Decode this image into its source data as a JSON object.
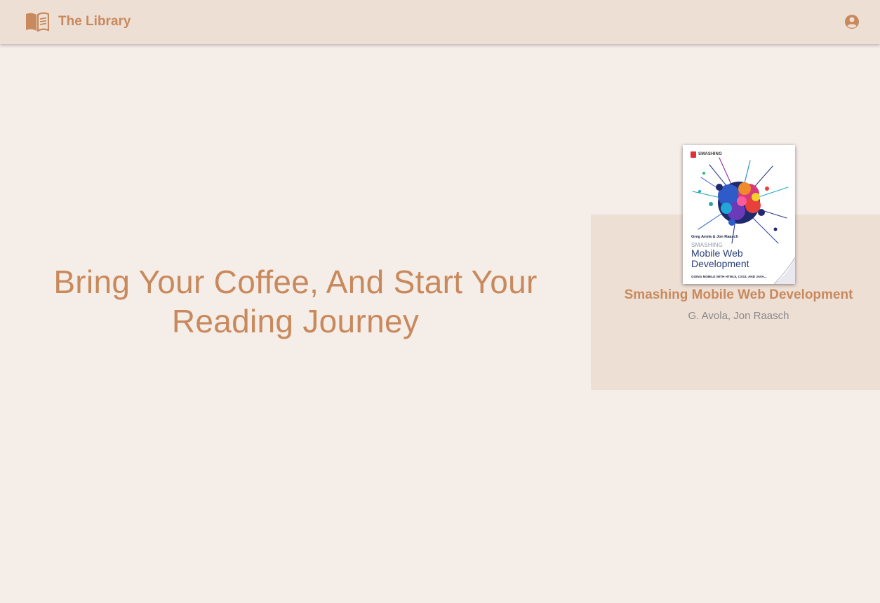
{
  "header": {
    "app_title": "The Library",
    "brand_icon": "open-book-icon",
    "account_icon": "account-circle-icon"
  },
  "hero": {
    "headline_line1": "Bring Your Coffee, And Start Your",
    "headline_line2": "Reading Journey"
  },
  "featured_book": {
    "title": "Smashing Mobile Web Development",
    "authors": "G. Avola, Jon Raasch",
    "cover": {
      "publisher": "SMASHING",
      "author_line": "Greg Avola & Jon Raasch",
      "series": "SMASHING",
      "title": "Mobile Web\nDevelopment",
      "subtitle": "GOING MOBILE WITH HTML5, CSS3, AND JAVA..."
    }
  },
  "colors": {
    "background": "#f5ede8",
    "header_bg": "#eedfd5",
    "accent": "#c8895c",
    "muted_text": "#8a8a8a"
  }
}
